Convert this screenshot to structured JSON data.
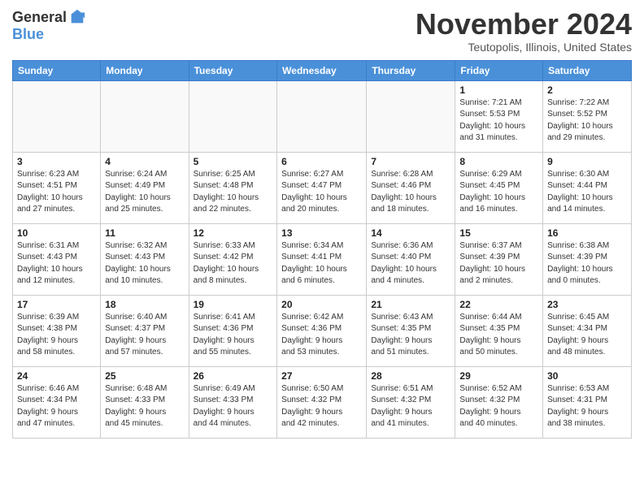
{
  "logo": {
    "general": "General",
    "blue": "Blue"
  },
  "title": "November 2024",
  "location": "Teutopolis, Illinois, United States",
  "days_of_week": [
    "Sunday",
    "Monday",
    "Tuesday",
    "Wednesday",
    "Thursday",
    "Friday",
    "Saturday"
  ],
  "weeks": [
    [
      {
        "day": "",
        "info": ""
      },
      {
        "day": "",
        "info": ""
      },
      {
        "day": "",
        "info": ""
      },
      {
        "day": "",
        "info": ""
      },
      {
        "day": "",
        "info": ""
      },
      {
        "day": "1",
        "info": "Sunrise: 7:21 AM\nSunset: 5:53 PM\nDaylight: 10 hours\nand 31 minutes."
      },
      {
        "day": "2",
        "info": "Sunrise: 7:22 AM\nSunset: 5:52 PM\nDaylight: 10 hours\nand 29 minutes."
      }
    ],
    [
      {
        "day": "3",
        "info": "Sunrise: 6:23 AM\nSunset: 4:51 PM\nDaylight: 10 hours\nand 27 minutes."
      },
      {
        "day": "4",
        "info": "Sunrise: 6:24 AM\nSunset: 4:49 PM\nDaylight: 10 hours\nand 25 minutes."
      },
      {
        "day": "5",
        "info": "Sunrise: 6:25 AM\nSunset: 4:48 PM\nDaylight: 10 hours\nand 22 minutes."
      },
      {
        "day": "6",
        "info": "Sunrise: 6:27 AM\nSunset: 4:47 PM\nDaylight: 10 hours\nand 20 minutes."
      },
      {
        "day": "7",
        "info": "Sunrise: 6:28 AM\nSunset: 4:46 PM\nDaylight: 10 hours\nand 18 minutes."
      },
      {
        "day": "8",
        "info": "Sunrise: 6:29 AM\nSunset: 4:45 PM\nDaylight: 10 hours\nand 16 minutes."
      },
      {
        "day": "9",
        "info": "Sunrise: 6:30 AM\nSunset: 4:44 PM\nDaylight: 10 hours\nand 14 minutes."
      }
    ],
    [
      {
        "day": "10",
        "info": "Sunrise: 6:31 AM\nSunset: 4:43 PM\nDaylight: 10 hours\nand 12 minutes."
      },
      {
        "day": "11",
        "info": "Sunrise: 6:32 AM\nSunset: 4:43 PM\nDaylight: 10 hours\nand 10 minutes."
      },
      {
        "day": "12",
        "info": "Sunrise: 6:33 AM\nSunset: 4:42 PM\nDaylight: 10 hours\nand 8 minutes."
      },
      {
        "day": "13",
        "info": "Sunrise: 6:34 AM\nSunset: 4:41 PM\nDaylight: 10 hours\nand 6 minutes."
      },
      {
        "day": "14",
        "info": "Sunrise: 6:36 AM\nSunset: 4:40 PM\nDaylight: 10 hours\nand 4 minutes."
      },
      {
        "day": "15",
        "info": "Sunrise: 6:37 AM\nSunset: 4:39 PM\nDaylight: 10 hours\nand 2 minutes."
      },
      {
        "day": "16",
        "info": "Sunrise: 6:38 AM\nSunset: 4:39 PM\nDaylight: 10 hours\nand 0 minutes."
      }
    ],
    [
      {
        "day": "17",
        "info": "Sunrise: 6:39 AM\nSunset: 4:38 PM\nDaylight: 9 hours\nand 58 minutes."
      },
      {
        "day": "18",
        "info": "Sunrise: 6:40 AM\nSunset: 4:37 PM\nDaylight: 9 hours\nand 57 minutes."
      },
      {
        "day": "19",
        "info": "Sunrise: 6:41 AM\nSunset: 4:36 PM\nDaylight: 9 hours\nand 55 minutes."
      },
      {
        "day": "20",
        "info": "Sunrise: 6:42 AM\nSunset: 4:36 PM\nDaylight: 9 hours\nand 53 minutes."
      },
      {
        "day": "21",
        "info": "Sunrise: 6:43 AM\nSunset: 4:35 PM\nDaylight: 9 hours\nand 51 minutes."
      },
      {
        "day": "22",
        "info": "Sunrise: 6:44 AM\nSunset: 4:35 PM\nDaylight: 9 hours\nand 50 minutes."
      },
      {
        "day": "23",
        "info": "Sunrise: 6:45 AM\nSunset: 4:34 PM\nDaylight: 9 hours\nand 48 minutes."
      }
    ],
    [
      {
        "day": "24",
        "info": "Sunrise: 6:46 AM\nSunset: 4:34 PM\nDaylight: 9 hours\nand 47 minutes."
      },
      {
        "day": "25",
        "info": "Sunrise: 6:48 AM\nSunset: 4:33 PM\nDaylight: 9 hours\nand 45 minutes."
      },
      {
        "day": "26",
        "info": "Sunrise: 6:49 AM\nSunset: 4:33 PM\nDaylight: 9 hours\nand 44 minutes."
      },
      {
        "day": "27",
        "info": "Sunrise: 6:50 AM\nSunset: 4:32 PM\nDaylight: 9 hours\nand 42 minutes."
      },
      {
        "day": "28",
        "info": "Sunrise: 6:51 AM\nSunset: 4:32 PM\nDaylight: 9 hours\nand 41 minutes."
      },
      {
        "day": "29",
        "info": "Sunrise: 6:52 AM\nSunset: 4:32 PM\nDaylight: 9 hours\nand 40 minutes."
      },
      {
        "day": "30",
        "info": "Sunrise: 6:53 AM\nSunset: 4:31 PM\nDaylight: 9 hours\nand 38 minutes."
      }
    ]
  ]
}
